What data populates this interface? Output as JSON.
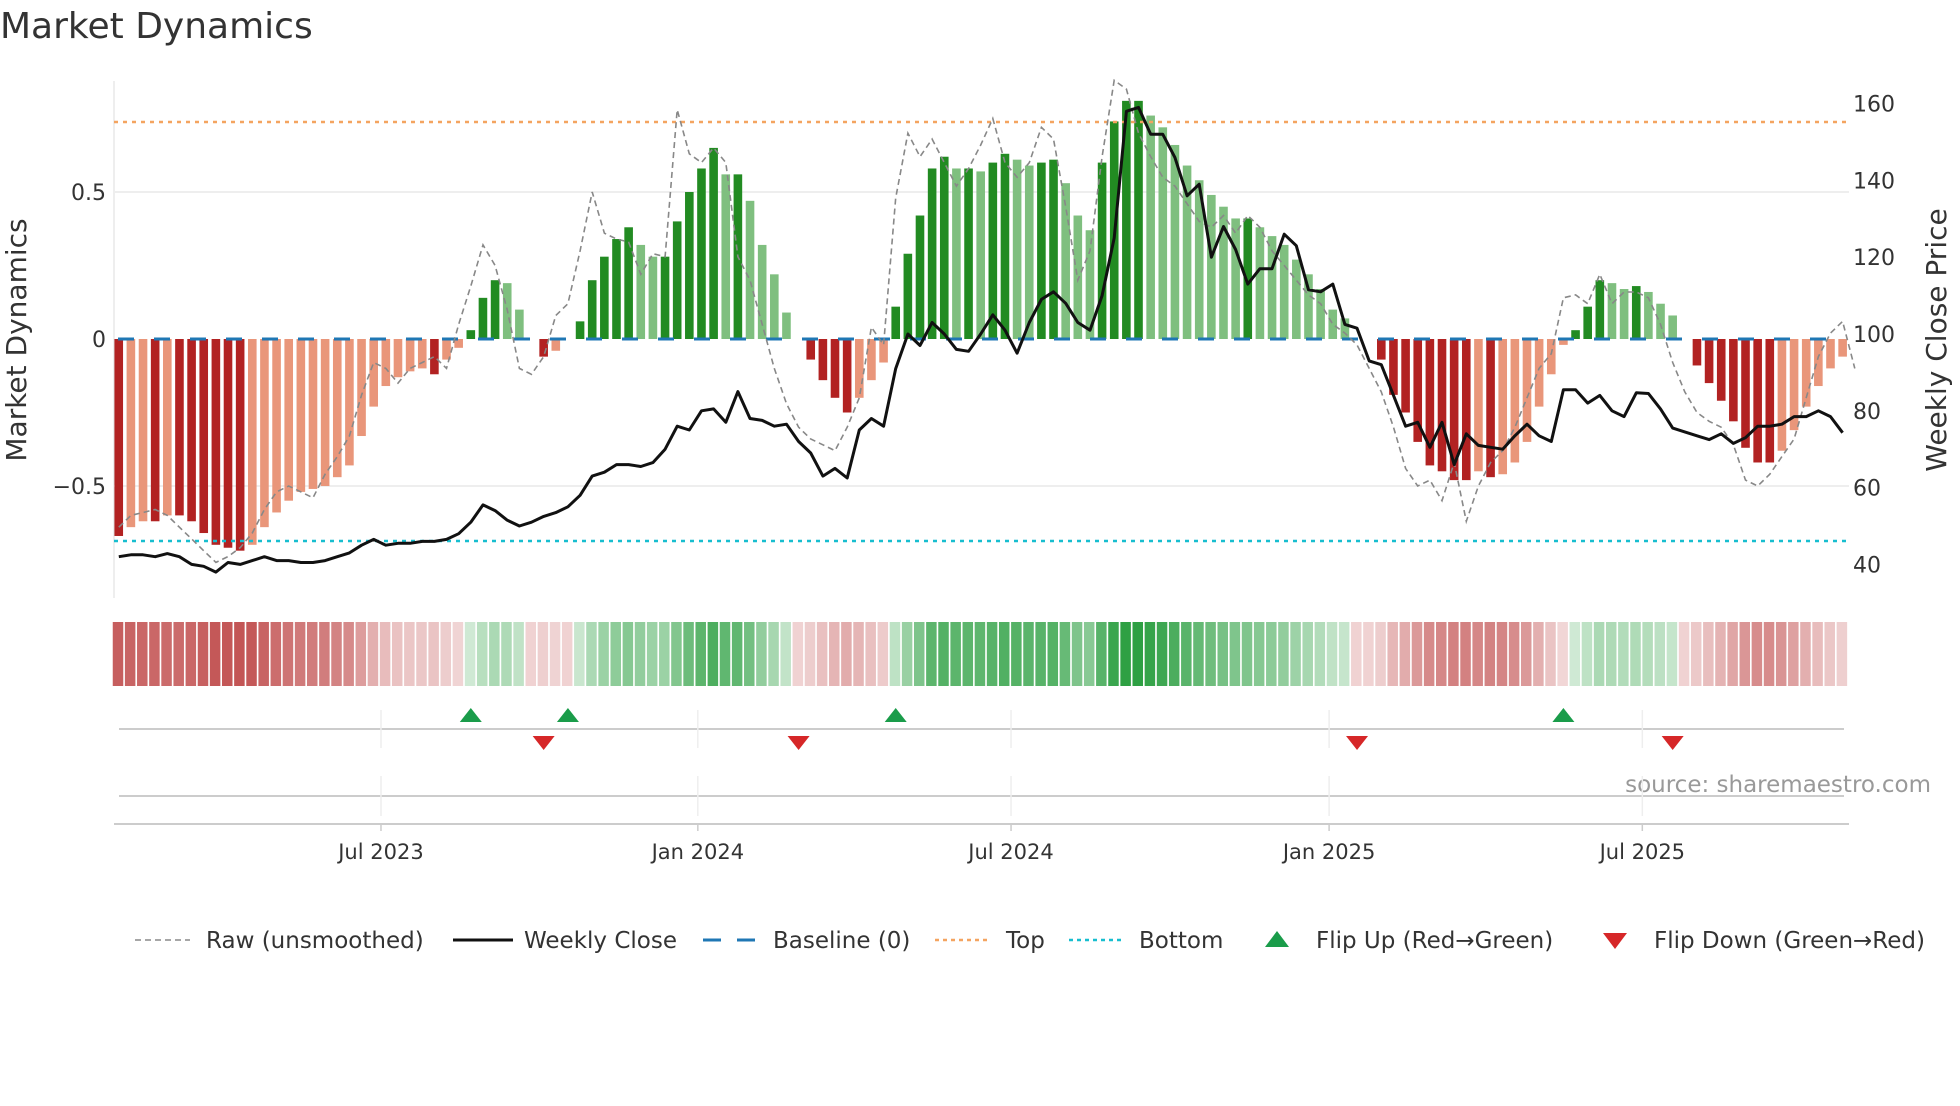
{
  "chart_data": {
    "type": "bar",
    "title": "Market Dynamics",
    "ylabel": "Market Dynamics",
    "ylabel_right": "Weekly Close Price",
    "ylim": [
      -0.82,
      0.89
    ],
    "ylim_right": [
      32,
      165
    ],
    "yticks": [
      {
        "v": 0.5,
        "label": "0.5"
      },
      {
        "v": 0,
        "label": "0"
      },
      {
        "v": -0.5,
        "label": "−0.5"
      }
    ],
    "yticks_right": [
      {
        "v": 40,
        "label": "40"
      },
      {
        "v": 60,
        "label": "60"
      },
      {
        "v": 80,
        "label": "80"
      },
      {
        "v": 100,
        "label": "100"
      },
      {
        "v": 120,
        "label": "120"
      },
      {
        "v": 140,
        "label": "140"
      },
      {
        "v": 160,
        "label": "160"
      }
    ],
    "x_unit": "week index",
    "xticks": [
      {
        "week": 21.6,
        "label": "Jul 2023"
      },
      {
        "week": 47.7,
        "label": "Jan 2024"
      },
      {
        "week": 73.5,
        "label": "Jul 2024"
      },
      {
        "week": 99.7,
        "label": "Jan 2025"
      },
      {
        "week": 125.5,
        "label": "Jul 2025"
      }
    ],
    "top_level": 0.738,
    "bottom_level": -0.687,
    "baseline": 0,
    "histogram": [
      -0.67,
      -0.64,
      -0.62,
      -0.62,
      -0.6,
      -0.6,
      -0.62,
      -0.66,
      -0.7,
      -0.71,
      -0.72,
      -0.7,
      -0.64,
      -0.59,
      -0.55,
      -0.52,
      -0.51,
      -0.5,
      -0.47,
      -0.43,
      -0.33,
      -0.23,
      -0.16,
      -0.13,
      -0.11,
      -0.1,
      -0.12,
      -0.07,
      -0.03,
      0.03,
      0.14,
      0.2,
      0.19,
      0.1,
      0,
      -0.06,
      -0.04,
      0,
      0.06,
      0.2,
      0.28,
      0.34,
      0.38,
      0.32,
      0.28,
      0.28,
      0.4,
      0.5,
      0.58,
      0.65,
      0.56,
      0.56,
      0.47,
      0.32,
      0.22,
      0.09,
      0,
      -0.07,
      -0.14,
      -0.2,
      -0.25,
      -0.2,
      -0.14,
      -0.08,
      0.11,
      0.29,
      0.42,
      0.58,
      0.62,
      0.58,
      0.58,
      0.57,
      0.6,
      0.63,
      0.61,
      0.59,
      0.6,
      0.61,
      0.53,
      0.42,
      0.37,
      0.6,
      0.74,
      0.81,
      0.81,
      0.76,
      0.72,
      0.66,
      0.59,
      0.54,
      0.49,
      0.45,
      0.41,
      0.41,
      0.38,
      0.35,
      0.32,
      0.27,
      0.22,
      0.17,
      0.1,
      0.07,
      0,
      0,
      -0.07,
      -0.19,
      -0.25,
      -0.35,
      -0.43,
      -0.45,
      -0.48,
      -0.48,
      -0.45,
      -0.47,
      -0.46,
      -0.42,
      -0.35,
      -0.23,
      -0.12,
      -0.02,
      0.03,
      0.11,
      0.2,
      0.19,
      0.17,
      0.18,
      0.16,
      0.12,
      0.08,
      0,
      -0.09,
      -0.15,
      -0.21,
      -0.28,
      -0.37,
      -0.42,
      -0.42,
      -0.38,
      -0.31,
      -0.23,
      -0.16,
      -0.1,
      -0.06
    ],
    "raw": [
      -0.64,
      -0.6,
      -0.59,
      -0.58,
      -0.6,
      -0.64,
      -0.68,
      -0.72,
      -0.76,
      -0.74,
      -0.71,
      -0.66,
      -0.58,
      -0.52,
      -0.5,
      -0.52,
      -0.54,
      -0.46,
      -0.4,
      -0.33,
      -0.19,
      -0.08,
      -0.1,
      -0.15,
      -0.1,
      -0.08,
      -0.06,
      -0.1,
      0.05,
      0.18,
      0.32,
      0.25,
      0.1,
      -0.1,
      -0.12,
      -0.06,
      0.08,
      0.12,
      0.3,
      0.5,
      0.36,
      0.34,
      0.33,
      0.22,
      0.29,
      0.28,
      0.78,
      0.63,
      0.6,
      0.65,
      0.6,
      0.28,
      0.2,
      0.05,
      -0.1,
      -0.22,
      -0.3,
      -0.34,
      -0.36,
      -0.38,
      -0.3,
      -0.2,
      0.04,
      -0.02,
      0.48,
      0.7,
      0.62,
      0.68,
      0.6,
      0.52,
      0.58,
      0.66,
      0.75,
      0.6,
      0.55,
      0.6,
      0.72,
      0.68,
      0.45,
      0.2,
      0.3,
      0.62,
      0.88,
      0.85,
      0.7,
      0.62,
      0.55,
      0.52,
      0.46,
      0.4,
      0.38,
      0.42,
      0.36,
      0.42,
      0.38,
      0.3,
      0.25,
      0.2,
      0.15,
      0.12,
      0.05,
      0.02,
      -0.02,
      -0.1,
      -0.18,
      -0.3,
      -0.44,
      -0.5,
      -0.48,
      -0.55,
      -0.42,
      -0.62,
      -0.5,
      -0.42,
      -0.38,
      -0.3,
      -0.2,
      -0.1,
      -0.05,
      0.14,
      0.15,
      0.12,
      0.22,
      0.12,
      0.16,
      0.16,
      0.14,
      0.05,
      -0.08,
      -0.18,
      -0.25,
      -0.28,
      -0.3,
      -0.36,
      -0.48,
      -0.5,
      -0.46,
      -0.4,
      -0.34,
      -0.2,
      -0.06,
      0.02,
      0.06,
      -0.1
    ],
    "close": [
      42,
      42.5,
      42.5,
      42,
      42.8,
      42,
      40,
      39.5,
      38,
      40.5,
      40,
      41,
      42,
      41,
      41,
      40.5,
      40.5,
      41,
      42,
      43,
      45,
      46.5,
      45,
      45.5,
      45.5,
      46,
      46,
      46.5,
      48,
      51,
      55.5,
      54,
      51.5,
      50,
      51,
      52.5,
      53.5,
      55,
      58,
      63,
      64,
      66,
      66,
      65.5,
      66.5,
      70,
      76,
      75,
      80,
      80.5,
      77,
      85,
      78,
      77.5,
      76,
      76.5,
      72,
      69,
      63,
      65,
      62.5,
      75,
      78,
      76,
      91,
      100,
      97,
      103,
      100,
      96,
      95.5,
      100,
      105,
      101,
      95,
      103,
      109,
      111,
      108,
      103,
      101,
      110,
      125,
      158,
      159,
      152,
      152,
      146,
      136,
      139,
      120,
      128,
      122,
      113,
      117,
      117,
      126,
      123,
      111.5,
      111,
      113,
      102.5,
      101.5,
      93,
      92,
      84,
      76,
      77,
      70.5,
      77,
      66,
      74,
      71,
      70.5,
      70,
      73.5,
      76.5,
      73.5,
      72,
      85.5,
      85.5,
      82,
      84,
      80,
      78.5,
      84.7,
      84.5,
      80.5,
      75.5,
      74.5,
      73.5,
      72.5,
      74,
      71.5,
      73,
      76,
      76,
      76.5,
      78.5,
      78.5,
      80,
      78.5,
      74.3
    ],
    "flip_up_weeks": [
      29,
      37,
      64,
      119
    ],
    "flip_down_weeks": [
      35,
      56,
      102,
      128
    ],
    "colors": {
      "pos_rising": "#228b22",
      "pos_falling": "#7fbf7f",
      "neg_falling": "#b22222",
      "neg_rising": "#e9967a",
      "raw": "#888888",
      "close": "#111111",
      "baseline": "#1f77b4",
      "top": "#f4a460",
      "bottom": "#17becf",
      "flip_up": "#1a9c4a",
      "flip_down": "#d62728"
    },
    "legend": [
      {
        "label": "Raw (unsmoothed)",
        "kind": "raw"
      },
      {
        "label": "Weekly Close",
        "kind": "close"
      },
      {
        "label": "Baseline (0)",
        "kind": "baseline"
      },
      {
        "label": "Top",
        "kind": "top"
      },
      {
        "label": "Bottom",
        "kind": "bottom"
      },
      {
        "label": "Flip Up (Red→Green)",
        "kind": "flip_up"
      },
      {
        "label": "Flip Down (Green→Red)",
        "kind": "flip_down"
      }
    ],
    "source": "source: sharemaestro.com"
  }
}
